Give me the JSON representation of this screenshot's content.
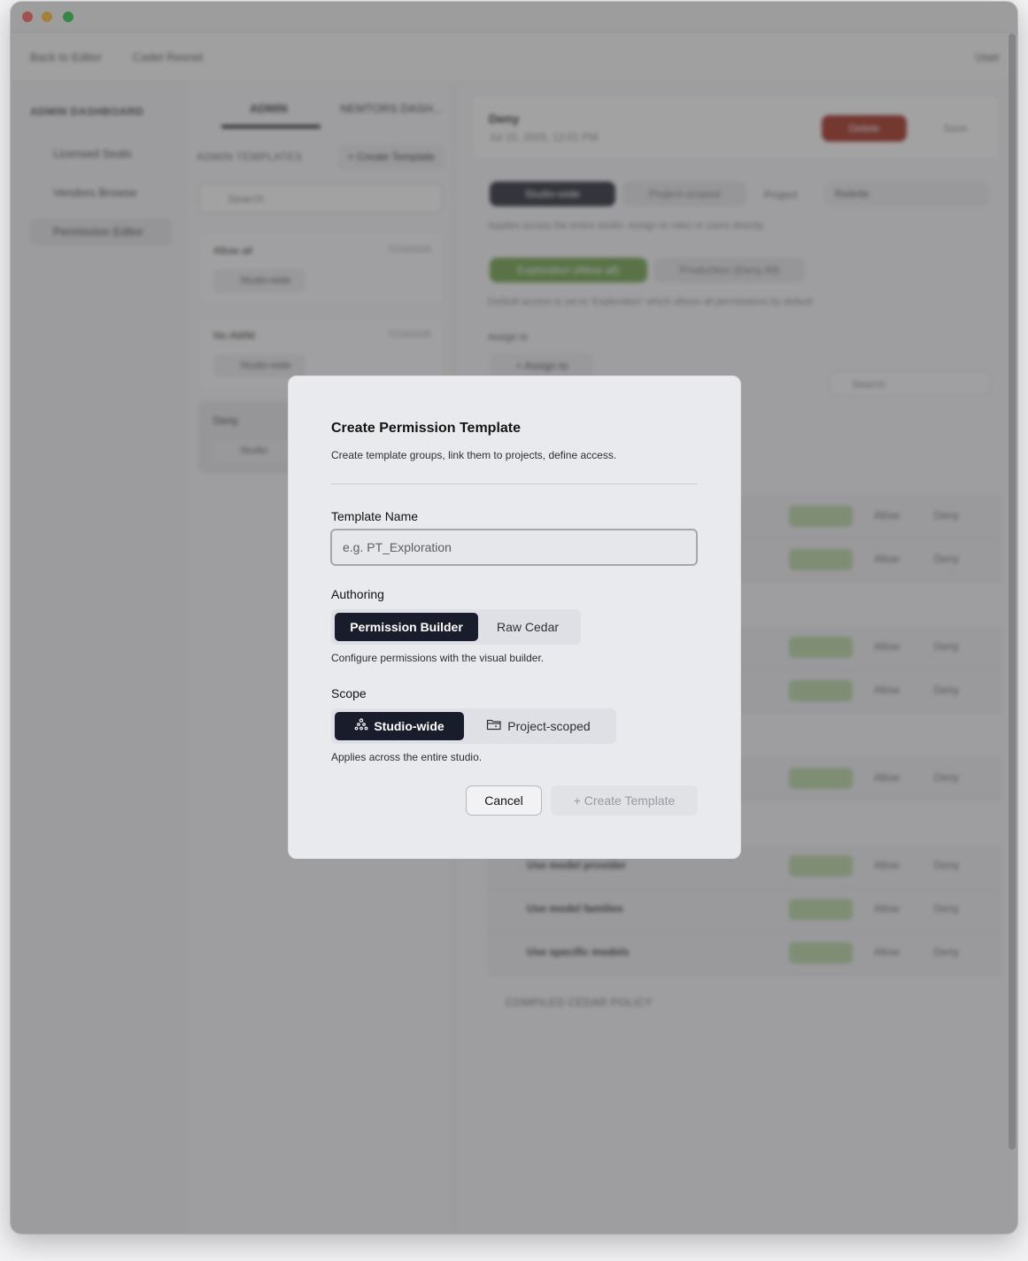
{
  "background": {
    "topnav": {
      "back": "Back to Editor",
      "breadcrumb": "Cadet Resnet",
      "user": "User"
    },
    "sidebar": {
      "header": "ADMIN DASHBOARD",
      "items": [
        {
          "label": "Licensed Seats",
          "icon": "seat-icon"
        },
        {
          "label": "Vendors Browse",
          "icon": "users-icon"
        },
        {
          "label": "Permission Editor",
          "icon": "lock-icon",
          "active": true
        }
      ]
    },
    "middle": {
      "tabs": [
        "ADMIN",
        "NEMTORS DASH..."
      ],
      "section": "ADMIN TEMPLATES",
      "create_button": "+ Create Template",
      "search_placeholder": "Search",
      "cards": [
        {
          "name": "Allow all",
          "date": "7/15/2025",
          "chip": "Studio-wide"
        },
        {
          "name": "No AWM",
          "date": "7/15/2025",
          "chip": "Studio-wide"
        },
        {
          "name": "Deny",
          "date": "",
          "chip": "Studio"
        }
      ]
    },
    "right": {
      "title": "Deny",
      "subtitle": "Jul 15, 2025, 12:01 PM",
      "delete": "Delete",
      "save": "Save",
      "scope_on": "Studio-wide",
      "scope_off": "Project-scoped",
      "project_label": "Project",
      "project_value": "Rebrite",
      "scope_desc": "Applies across the entire studio. Assign to roles or users directly.",
      "mode_on": "Exploration (Allow all)",
      "mode_off": "Production (Deny All)",
      "mode_desc": "Default access is set to 'Exploration' which allows all permissions by default.",
      "assign_label": "Assign to",
      "assign_button": "+ Assign to",
      "search": "Search",
      "rows": [
        {
          "label": "",
          "allow": "Allow",
          "deny": "Deny"
        },
        {
          "label": "",
          "allow": "Allow",
          "deny": "Deny"
        },
        {
          "label": "",
          "allow": "Allow",
          "deny": "Deny"
        },
        {
          "label": "",
          "allow": "Allow",
          "deny": "Deny"
        },
        {
          "label": "",
          "allow": "Allow",
          "deny": "Deny"
        },
        {
          "label": "Use model provider",
          "allow": "Allow",
          "deny": "Deny"
        },
        {
          "label": "Use model families",
          "allow": "Allow",
          "deny": "Deny"
        },
        {
          "label": "Use specific models",
          "allow": "Allow",
          "deny": "Deny"
        }
      ],
      "footer": "COMPILED CEDAR POLICY"
    }
  },
  "modal": {
    "title": "Create Permission Template",
    "description": "Create template groups, link them to projects, define access.",
    "template_name": {
      "label": "Template Name",
      "placeholder": "e.g. PT_Exploration",
      "value": ""
    },
    "authoring": {
      "label": "Authoring",
      "options": [
        "Permission Builder",
        "Raw Cedar"
      ],
      "selected": "Permission Builder",
      "help": "Configure permissions with the visual builder."
    },
    "scope": {
      "label": "Scope",
      "options": [
        {
          "label": "Studio-wide",
          "icon": "network-icon"
        },
        {
          "label": "Project-scoped",
          "icon": "folder-icon"
        }
      ],
      "selected": "Studio-wide",
      "help": "Applies across the entire studio."
    },
    "buttons": {
      "cancel": "Cancel",
      "create": "Create Template",
      "create_prefix": "+"
    }
  },
  "colors": {
    "accent_dark": "#191c2b",
    "danger": "#a32a1b",
    "success_chip": "#b7d59f",
    "overlay": "rgba(70,70,72,0.50)"
  }
}
